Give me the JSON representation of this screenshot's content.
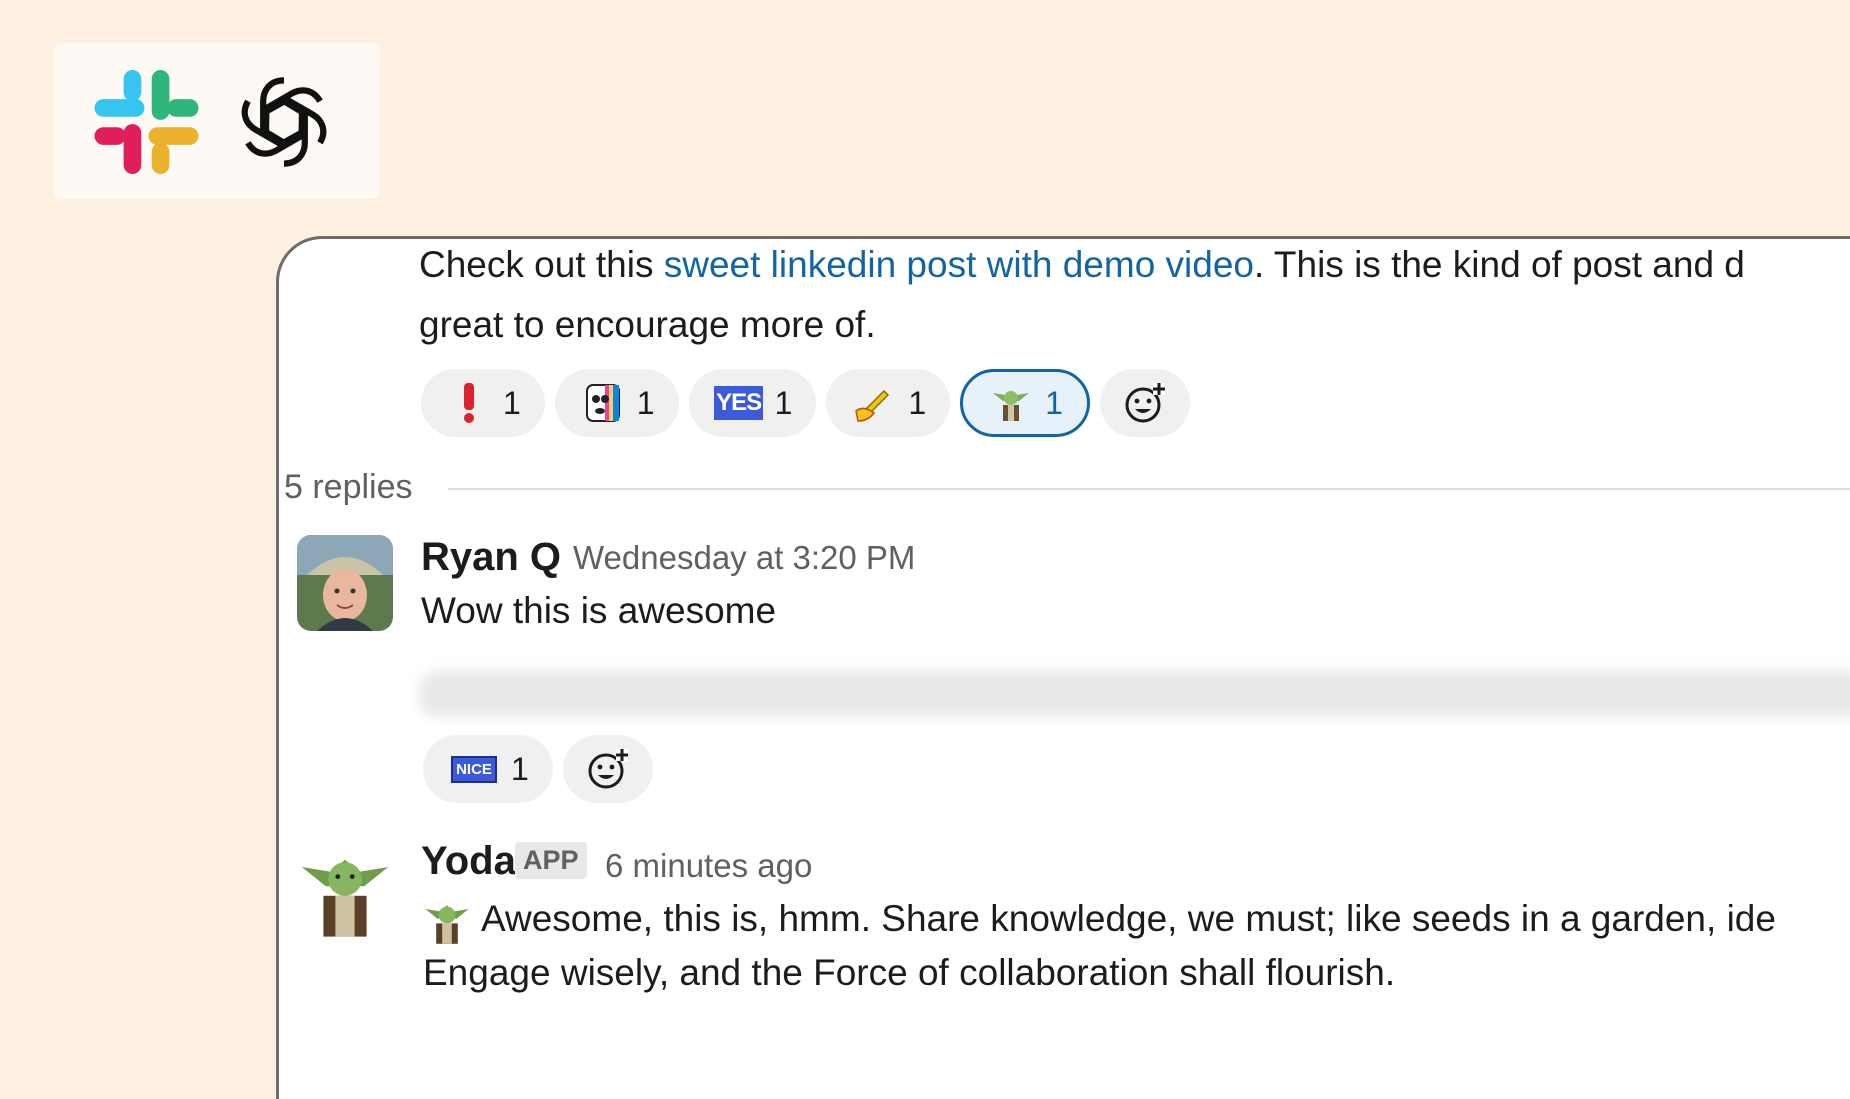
{
  "logos": {
    "slack": "slack-logo",
    "openai": "openai-logo"
  },
  "thread": {
    "parent": {
      "line1_before": "Check out this ",
      "link": "sweet linkedin post with demo video",
      "line1_after": ". This is the kind of post and d",
      "line2": "great to encourage more of."
    },
    "parent_reactions": [
      {
        "emoji": "exclamation-icon",
        "count": "1"
      },
      {
        "emoji": "party-face-icon",
        "count": "1"
      },
      {
        "emoji": "yes-badge-icon",
        "label": "YES",
        "count": "1"
      },
      {
        "emoji": "writing-hand-icon",
        "count": "1"
      },
      {
        "emoji": "yoda-icon",
        "count": "1"
      }
    ],
    "replies_count": "5 replies",
    "reply1": {
      "name": "Ryan Q",
      "time": "Wednesday at 3:20 PM",
      "text": "Wow this is awesome",
      "reactions": [
        {
          "emoji": "nice-badge-icon",
          "label": "NICE",
          "count": "1"
        }
      ]
    },
    "reply2": {
      "name": "Yoda",
      "badge": "APP",
      "time": "6 minutes ago",
      "line1": "Awesome, this is, hmm. Share knowledge, we must; like seeds in a garden, ide",
      "line2": "Engage wisely, and the Force of collaboration shall flourish."
    }
  },
  "colors": {
    "link": "#1264a3",
    "background": "#fdf0e1"
  }
}
